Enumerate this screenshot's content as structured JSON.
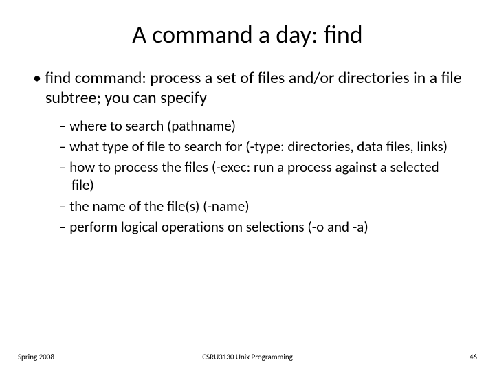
{
  "title": "A command a day: find",
  "main_bullet": "find command: process a set of files and/or directories in a file subtree; you can specify",
  "sub_bullets": [
    "where to search (pathname)",
    "what type of file to search for (-type: directories, data files, links)",
    "how to process the files (-exec: run a process against a selected file)",
    "the name of the file(s) (-name)",
    "perform logical operations on selections (-o and -a)"
  ],
  "footer": {
    "left": "Spring 2008",
    "center": "CSRU3130 Unix Programming",
    "right": "46"
  }
}
